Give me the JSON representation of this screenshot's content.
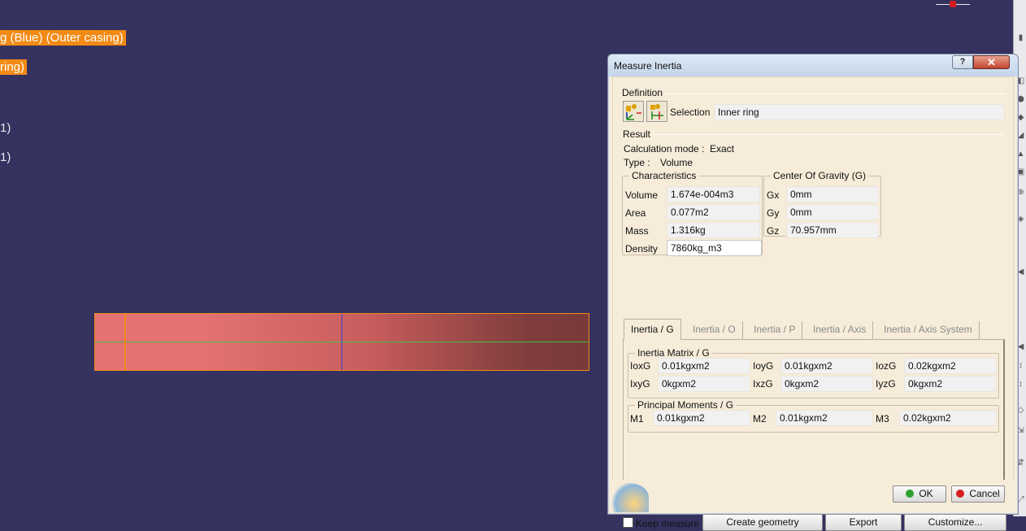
{
  "viewport": {
    "labels": [
      {
        "text": "g (Blue) (Outer casing)",
        "highlight": true
      },
      {
        "text": "ring)",
        "highlight": true
      },
      {
        "text": "1)",
        "highlight": false
      },
      {
        "text": "1)",
        "highlight": false
      }
    ],
    "colors": {
      "background": "#35325f",
      "highlight": "#f28a14"
    }
  },
  "dialog": {
    "title": "Measure Inertia",
    "help_glyph": "?",
    "close_glyph": "✕",
    "definition": {
      "label": "Definition",
      "selection_label": "Selection :",
      "selection_value": "Inner ring",
      "icons": [
        "measure-inertia-3d-icon",
        "measure-inertia-2d-icon"
      ]
    },
    "result": {
      "label": "Result",
      "calc_mode_label": "Calculation mode :",
      "calc_mode_value": "Exact",
      "type_label": "Type :",
      "type_value": "Volume"
    },
    "characteristics": {
      "label": "Characteristics",
      "rows": [
        {
          "label": "Volume",
          "value": "1.674e-004m3"
        },
        {
          "label": "Area",
          "value": "0.077m2"
        },
        {
          "label": "Mass",
          "value": "1.316kg"
        },
        {
          "label": "Density",
          "value": "7860kg_m3"
        }
      ]
    },
    "center_of_gravity": {
      "label": "Center Of Gravity (G)",
      "rows": [
        {
          "label": "Gx",
          "value": "0mm"
        },
        {
          "label": "Gy",
          "value": "0mm"
        },
        {
          "label": "Gz",
          "value": "70.957mm"
        }
      ]
    },
    "tabs": [
      "Inertia / G",
      "Inertia / O",
      "Inertia / P",
      "Inertia / Axis",
      "Inertia / Axis System"
    ],
    "active_tab": "Inertia / G",
    "inertia_matrix": {
      "label": "Inertia Matrix / G",
      "row1": [
        {
          "label": "IoxG",
          "value": "0.01kgxm2"
        },
        {
          "label": "IoyG",
          "value": "0.01kgxm2"
        },
        {
          "label": "IozG",
          "value": "0.02kgxm2"
        }
      ],
      "row2": [
        {
          "label": "IxyG",
          "value": "0kgxm2"
        },
        {
          "label": "IxzG",
          "value": "0kgxm2"
        },
        {
          "label": "IyzG",
          "value": "0kgxm2"
        }
      ]
    },
    "principal_moments": {
      "label": "Principal Moments / G",
      "values": [
        {
          "label": "M1",
          "value": "0.01kgxm2"
        },
        {
          "label": "M2",
          "value": "0.01kgxm2"
        },
        {
          "label": "M3",
          "value": "0.02kgxm2"
        }
      ]
    },
    "keep_measure": {
      "label": "Keep measure",
      "checked": false
    },
    "buttons": {
      "create_geometry": "Create geometry",
      "export": "Export",
      "customize": "Customize...",
      "ok": "OK",
      "cancel": "Cancel"
    },
    "colors": {
      "dialog_bg": "#f6ecd9",
      "ok_icon": "#2ea12e",
      "cancel_icon": "#d42020"
    }
  }
}
